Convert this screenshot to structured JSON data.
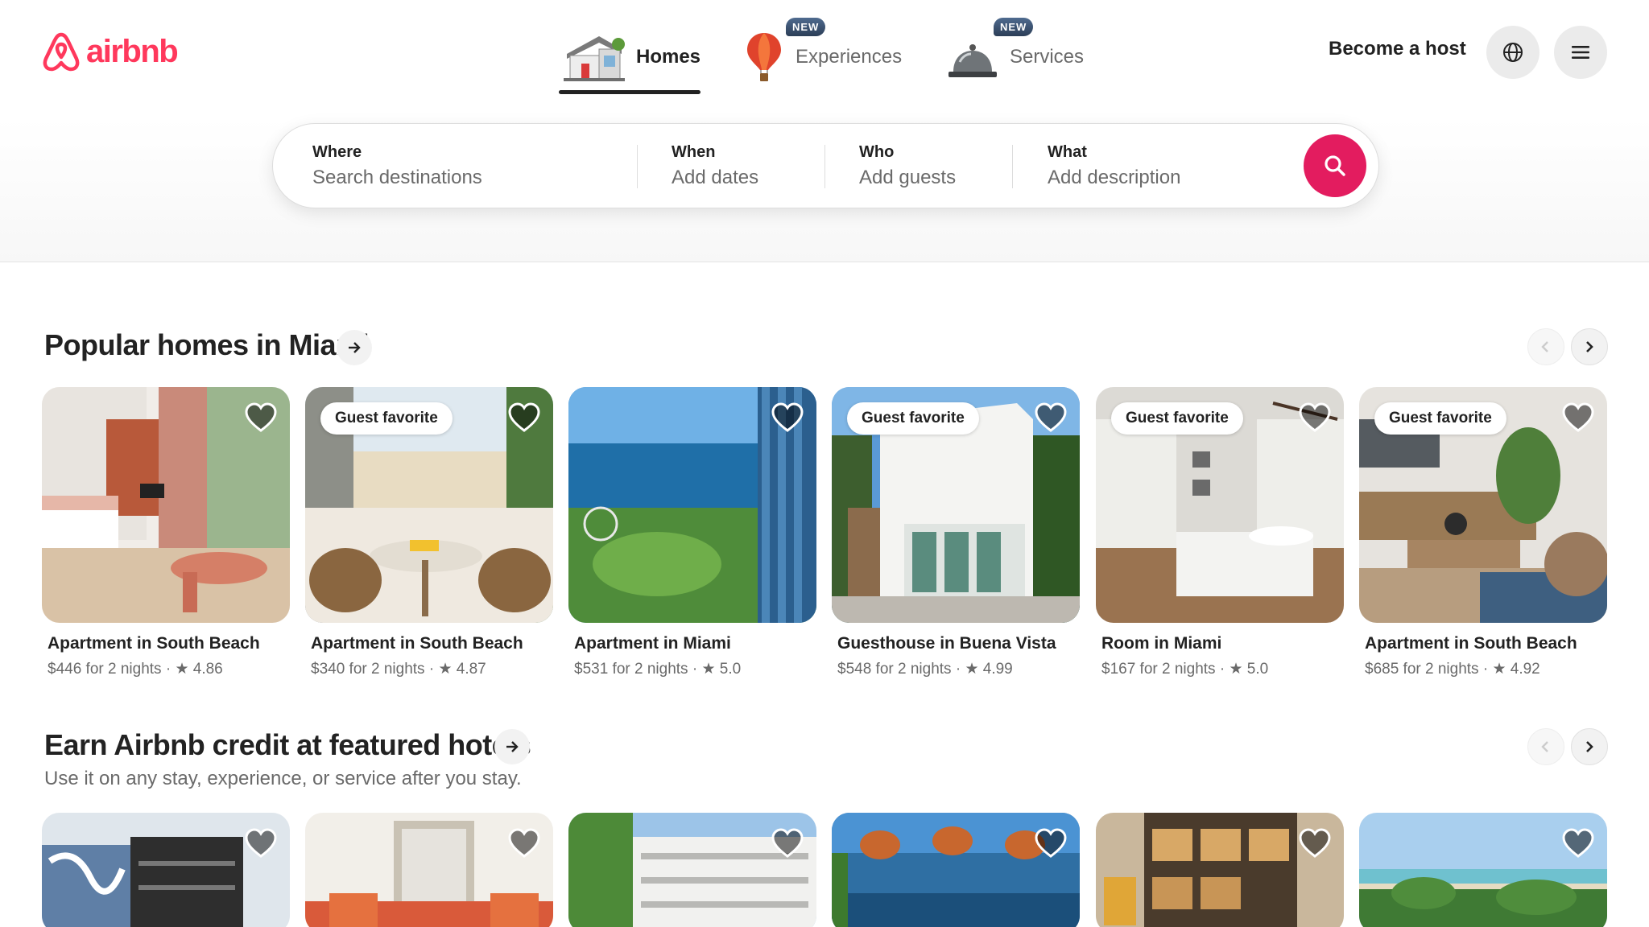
{
  "brand": {
    "name": "airbnb",
    "color": "#ff385c"
  },
  "nav": {
    "tabs": [
      {
        "label": "Homes",
        "icon": "house-icon",
        "active": true,
        "badge": ""
      },
      {
        "label": "Experiences",
        "icon": "hot-air-balloon-icon",
        "active": false,
        "badge": "NEW"
      },
      {
        "label": "Services",
        "icon": "service-bell-icon",
        "active": false,
        "badge": "NEW"
      }
    ],
    "become_host": "Become a host",
    "language_icon": "globe-icon",
    "menu_icon": "hamburger-menu-icon"
  },
  "search": {
    "where": {
      "label": "Where",
      "placeholder": "Search destinations"
    },
    "when": {
      "label": "When",
      "placeholder": "Add dates"
    },
    "who": {
      "label": "Who",
      "placeholder": "Add guests"
    },
    "what": {
      "label": "What",
      "placeholder": "Add description"
    },
    "button_icon": "search-icon",
    "button_color": "#e31c5f"
  },
  "popular": {
    "title": "Popular homes in Miami",
    "listings": [
      {
        "title": "Apartment in South Beach",
        "price": "$446 for 2 nights",
        "rating": "★ 4.86",
        "badge": ""
      },
      {
        "title": "Apartment in South Beach",
        "price": "$340 for 2 nights",
        "rating": "★ 4.87",
        "badge": "Guest favorite"
      },
      {
        "title": "Apartment in Miami",
        "price": "$531 for 2 nights",
        "rating": "★ 5.0",
        "badge": ""
      },
      {
        "title": "Guesthouse in Buena Vista",
        "price": "$548 for 2 nights",
        "rating": "★ 4.99",
        "badge": "Guest favorite"
      },
      {
        "title": "Room in Miami",
        "price": "$167 for 2 nights",
        "rating": "★ 5.0",
        "badge": "Guest favorite"
      },
      {
        "title": "Apartment in South Beach",
        "price": "$685 for 2 nights",
        "rating": "★ 4.92",
        "badge": "Guest favorite"
      }
    ]
  },
  "hotels": {
    "title": "Earn Airbnb credit at featured hotels",
    "subtitle": "Use it on any stay, experience, or service after you stay."
  },
  "separator": "·"
}
